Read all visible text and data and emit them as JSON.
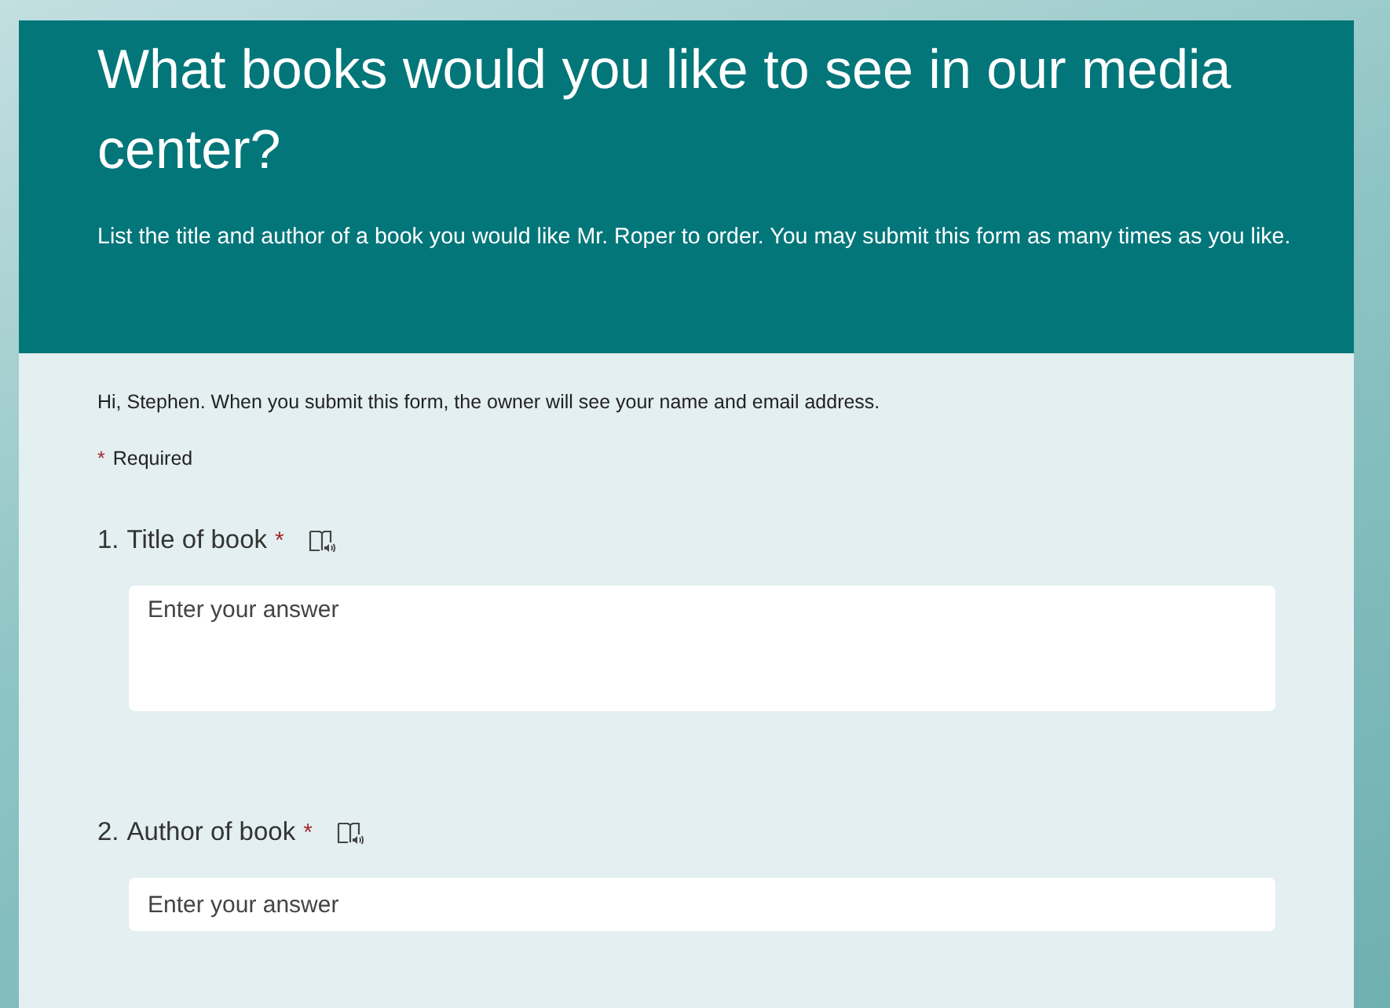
{
  "form": {
    "title": "What books would you like to see in our media center?",
    "description": "List the title and author of a book you would like Mr. Roper to order. You may submit this form as many times as you like.",
    "notice": "Hi, Stephen. When you submit this form, the owner will see your name and email address.",
    "required_mark": "*",
    "required_label": "Required"
  },
  "questions": [
    {
      "number": "1.",
      "title": "Title of book",
      "required": true,
      "kind": "long",
      "placeholder": "Enter your answer"
    },
    {
      "number": "2.",
      "title": "Author of book",
      "required": true,
      "kind": "short",
      "placeholder": "Enter your answer"
    }
  ]
}
